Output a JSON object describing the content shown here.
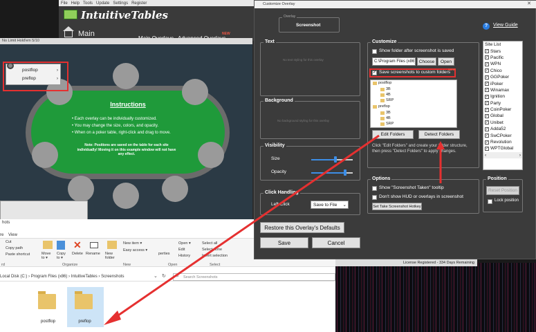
{
  "app": {
    "menu": [
      "File",
      "Help",
      "Tools",
      "Update",
      "Settings",
      "Register"
    ],
    "title": "IntuitiveTables",
    "main_label": "Main",
    "tabs": [
      "Main Overlays",
      "Advanced Overlays"
    ],
    "new_badge": "NEW",
    "status": "License Registered - 334 Days Remaining"
  },
  "table_preview": {
    "window_title": "No Limit Hold'em 5/10",
    "context_menu": [
      {
        "label": "postflop",
        "arrow": "›"
      },
      {
        "label": "preflop",
        "arrow": "›"
      }
    ],
    "instructions_title": "Instructions",
    "instructions": [
      "• Each overlay can be individually customized.",
      "• You may change the size, colors, and opacity.",
      "• When on a poker table, right-click and drag to move."
    ],
    "note": "Note: Positions are saved on the table for each site individually! Moving it on this example window will not have any effect."
  },
  "explorer": {
    "title": "hots",
    "tabs": "re    View",
    "ribbon": {
      "cut": "Cut",
      "copy_path": "Copy path",
      "paste_shortcut": "Paste shortcut",
      "move_to": "Move to ▾",
      "copy_to": "Copy to ▾",
      "delete": "Delete",
      "rename": "Rename",
      "new_folder": "New folder",
      "new_item": "New item ▾",
      "easy_access": "Easy access ▾",
      "properties": "perties",
      "open": "Open ▾",
      "edit": "Edit",
      "history": "History",
      "select_all": "Select all",
      "select_none": "Select none",
      "invert_selection": "Invert selection",
      "sections": [
        "rd",
        "Organize",
        "New",
        "Open",
        "Select"
      ]
    },
    "path": [
      "Local Disk (C:)",
      "Program Files (x86)",
      "IntuitiveTables",
      "Screenshots"
    ],
    "search_placeholder": "Search Screenshots",
    "folders": [
      "postflop",
      "preflop"
    ]
  },
  "dialog": {
    "title": "Customize Overlay",
    "help_icon": "?",
    "view_guide": "View Guide",
    "overlay_group": "Overlay",
    "overlay_name": "Screenshot",
    "text_group": "Text",
    "text_placeholder": "No text styling for this overlay",
    "background_group": "Background",
    "background_placeholder": "No background styling for this overlay",
    "visibility_group": "Visibility",
    "size_label": "Size",
    "size_value": 0.58,
    "opacity_label": "Opacity",
    "opacity_value": 0.82,
    "click_group": "Click Handling",
    "left_click_label": "Left Click",
    "left_click_value": "Save to File",
    "restore_button": "Restore this Overlay's Defaults",
    "save_button": "Save",
    "cancel_button": "Cancel",
    "customize_group": "Customize",
    "show_folder_label": "Show folder after screenshot is saved",
    "path_value": "C:\\Program Files (x86)\\Int",
    "choose_button": "Choose",
    "open_button": "Open",
    "save_custom_label": "Save screenshots to custom folders",
    "save_custom_new": "NEW",
    "tree": [
      {
        "name": "postflop",
        "level": 0
      },
      {
        "name": "3B",
        "level": 1
      },
      {
        "name": "4B",
        "level": 1
      },
      {
        "name": "SRP",
        "level": 1
      },
      {
        "name": "preflop",
        "level": 0
      },
      {
        "name": "3B",
        "level": 1
      },
      {
        "name": "4B",
        "level": 1
      },
      {
        "name": "SRP",
        "level": 1
      }
    ],
    "edit_folders_button": "Edit Folders",
    "detect_folders_button": "Detect Folders",
    "help_text": "Click \"Edit Folders\" and create your folder structure, then press \"Detect Folders\" to apply changes.",
    "options_group": "Options",
    "show_tooltip_label": "Show \"Screenshot Taken\" tooltip",
    "dont_show_label": "Don't show HUD or overlays in screenshot",
    "hotkey_button": "Set Take Screenshot Hotkey",
    "site_list_title": "Site List",
    "sites": [
      "Stars",
      "Pacific",
      "WPN",
      "Chico",
      "GGPoker",
      "iPoker",
      "Winamax",
      "Ignition",
      "Party",
      "CoinPoker",
      "Global",
      "Unibet",
      "Adda52",
      "SwCPoker",
      "Revolution",
      "WPTGlobal"
    ],
    "position_group": "Position",
    "reset_position_button": "Reset Position",
    "lock_position_label": "Lock position"
  },
  "colors": {
    "highlight": "#e53030",
    "felt": "#1f9a3a",
    "accent": "#3d8ee6"
  }
}
